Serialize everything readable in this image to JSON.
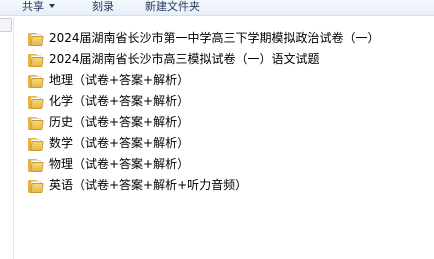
{
  "toolbar": {
    "share_label": "共享",
    "burn_label": "刻录",
    "new_folder_label": "新建文件夹"
  },
  "icons": {
    "folder": "folder-icon",
    "dropdown": "chevron-down-icon"
  },
  "colors": {
    "toolbar_text": "#1e395b",
    "folder_yellow": "#e8b748"
  },
  "files": [
    {
      "name": "2024届湖南省长沙市第一中学高三下学期模拟政治试卷（一）"
    },
    {
      "name": "2024届湖南省长沙市高三模拟试卷（一）语文试题"
    },
    {
      "name": "地理（试卷+答案+解析）"
    },
    {
      "name": "化学（试卷+答案+解析）"
    },
    {
      "name": "历史（试卷+答案+解析）"
    },
    {
      "name": "数学（试卷+答案+解析）"
    },
    {
      "name": "物理（试卷+答案+解析）"
    },
    {
      "name": "英语（试卷+答案+解析+听力音频）"
    }
  ]
}
